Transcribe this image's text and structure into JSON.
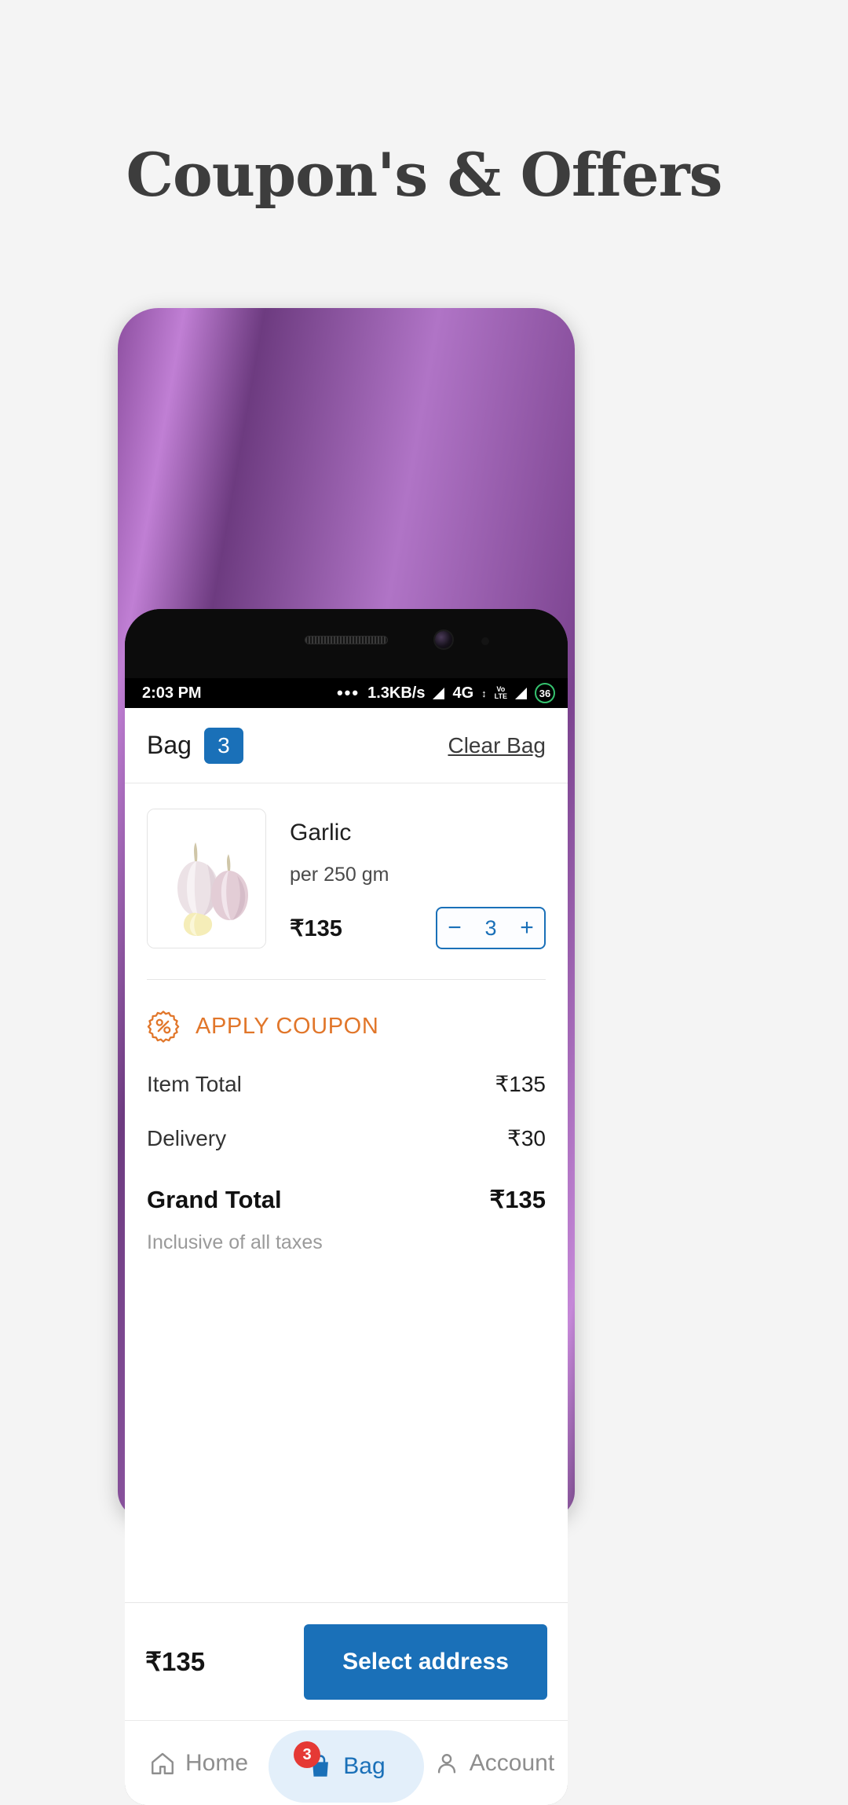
{
  "page": {
    "headline": "Coupon's & Offers"
  },
  "status_bar": {
    "time": "2:03 PM",
    "overflow_dots": "•••",
    "data_speed": "1.3KB/s",
    "network_type": "4G",
    "volte_top": "Vo",
    "volte_sup": "))",
    "volte_bottom": "LTE",
    "data_arrows": "↕",
    "battery_percent": "36",
    "battery_color": "#35c26e"
  },
  "header": {
    "bag_title": "Bag",
    "bag_count": "3",
    "clear_bag_label": "Clear Bag",
    "badge_color": "#1a70b8"
  },
  "cart": {
    "item": {
      "name": "Garlic",
      "weight": "per 250 gm",
      "price": "₹135",
      "image_alt": "garlic-bulbs-photo",
      "quantity": "3",
      "decrement_label": "−",
      "increment_label": "+"
    }
  },
  "coupon": {
    "icon_name": "percent-badge-icon",
    "label": "APPLY COUPON",
    "color": "#e1762a"
  },
  "totals": {
    "lines": [
      {
        "label": "Item Total",
        "value": "₹135"
      },
      {
        "label": "Delivery",
        "value": "₹30"
      }
    ],
    "grand": {
      "label": "Grand Total",
      "value": "₹135"
    },
    "tax_note": "Inclusive of all taxes"
  },
  "checkout": {
    "total": "₹135",
    "button_label": "Select address",
    "button_color": "#1a70b8"
  },
  "bottom_nav": {
    "items": [
      {
        "label": "Home",
        "icon": "home-icon",
        "active": false,
        "badge": ""
      },
      {
        "label": "Bag",
        "icon": "bag-icon",
        "active": true,
        "badge": "3"
      },
      {
        "label": "Account",
        "icon": "person-icon",
        "active": false,
        "badge": ""
      }
    ]
  }
}
